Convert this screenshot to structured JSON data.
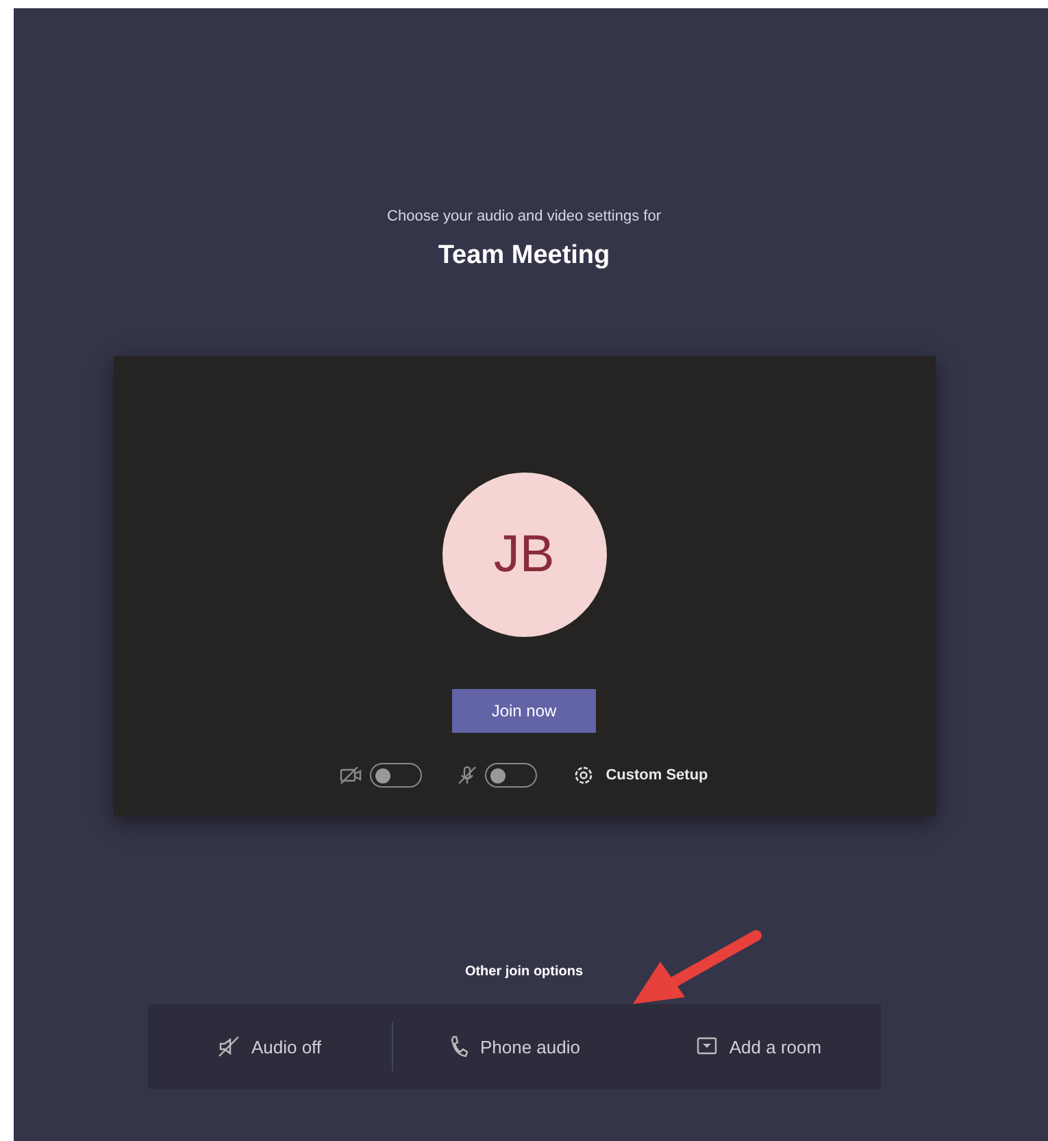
{
  "heading": {
    "subtitle": "Choose your audio and video settings for",
    "title": "Team Meeting"
  },
  "preview": {
    "avatar_initials": "JB",
    "join_button": "Join now",
    "toggles": [
      {
        "kind": "camera",
        "on": false
      },
      {
        "kind": "mic",
        "on": false
      }
    ],
    "custom_setup": "Custom Setup"
  },
  "other_options": {
    "label": "Other join options",
    "options": [
      {
        "kind": "audio-off",
        "label": "Audio off"
      },
      {
        "kind": "phone",
        "label": "Phone audio"
      },
      {
        "kind": "room",
        "label": "Add a room"
      }
    ]
  },
  "annotation": {
    "kind": "arrow"
  }
}
